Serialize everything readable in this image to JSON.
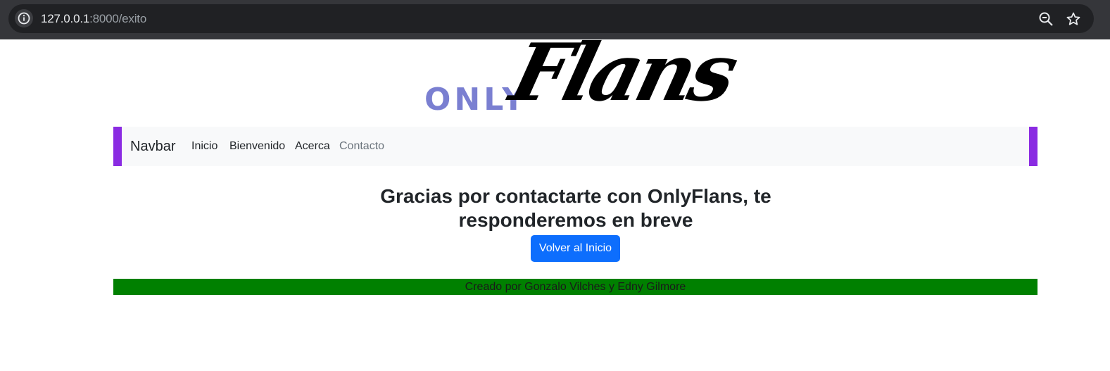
{
  "browser": {
    "url_host": "127.0.0.1",
    "url_rest": ":8000/exito",
    "icons": [
      "info-icon",
      "zoom-icon",
      "star-icon"
    ]
  },
  "logo": {
    "only": "ONLY",
    "flans": "Flans",
    "only_color": "#7a7fd1"
  },
  "navbar": {
    "brand": "Navbar",
    "links": [
      "Inicio",
      "Bienvenido",
      "Acerca",
      "Contacto"
    ],
    "accent": "#8a2be2"
  },
  "main": {
    "message_line1": "Gracias por contactarte con OnlyFlans, te",
    "message_line2": "responderemos en breve",
    "button_label": "Volver al Inicio",
    "button_color": "#0d6efd"
  },
  "footer": {
    "text": "Creado por Gonzalo Vilches y Edny Gilmore",
    "color": "#008000"
  }
}
